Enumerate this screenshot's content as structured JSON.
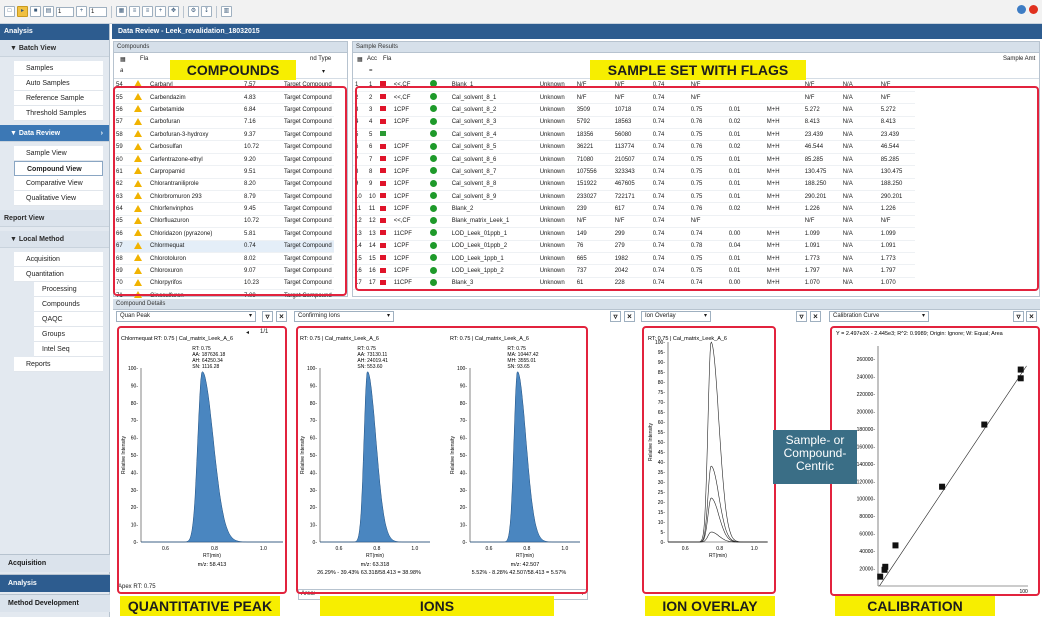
{
  "toolbar": {
    "field1": "1",
    "field2": "1"
  },
  "leftnav": {
    "header": "Analysis",
    "batch_view": {
      "title": "Batch View",
      "items": [
        "Samples",
        "Auto Samples",
        "Reference Sample",
        "Threshold Samples"
      ]
    },
    "data_review": {
      "title": "Data Review",
      "items": [
        "Sample View",
        "Compound View",
        "Comparative View",
        "Qualitative View"
      ]
    },
    "report_view": "Report View",
    "local_method": {
      "title": "Local Method",
      "items": [
        "Acquisition",
        "Quantitation"
      ],
      "sub_items": [
        "Processing",
        "Compounds",
        "QAQC",
        "Groups",
        "Intel Seq"
      ],
      "reports": "Reports"
    },
    "bottom": [
      "Acquisition",
      "Analysis",
      "Method Development"
    ]
  },
  "main": {
    "title": "Data Review - Leek_revalidation_18032015"
  },
  "compounds": {
    "title": "Compounds",
    "col_flag": "Fla",
    "col_type": "nd Type",
    "filter": "a",
    "rows": [
      {
        "n": "54",
        "name": "Carbaryl",
        "rt": "7.57",
        "type": "Target Compound"
      },
      {
        "n": "55",
        "name": "Carbendazim",
        "rt": "4.83",
        "type": "Target Compound"
      },
      {
        "n": "56",
        "name": "Carbetamide",
        "rt": "6.84",
        "type": "Target Compound"
      },
      {
        "n": "57",
        "name": "Carbofuran",
        "rt": "7.16",
        "type": "Target Compound"
      },
      {
        "n": "58",
        "name": "Carbofuran-3-hydroxy",
        "rt": "9.37",
        "type": "Target Compound"
      },
      {
        "n": "59",
        "name": "Carbosulfan",
        "rt": "10.72",
        "type": "Target Compound"
      },
      {
        "n": "60",
        "name": "Carfentrazone-ethyl",
        "rt": "9.20",
        "type": "Target Compound"
      },
      {
        "n": "61",
        "name": "Carpropamid",
        "rt": "9.51",
        "type": "Target Compound"
      },
      {
        "n": "62",
        "name": "Chlorantraniliprole",
        "rt": "8.20",
        "type": "Target Compound"
      },
      {
        "n": "63",
        "name": "Chlorbromuron 293",
        "rt": "8.79",
        "type": "Target Compound"
      },
      {
        "n": "64",
        "name": "Chlorfenvinphos",
        "rt": "9.45",
        "type": "Target Compound"
      },
      {
        "n": "65",
        "name": "Chlorfluazuron",
        "rt": "10.72",
        "type": "Target Compound"
      },
      {
        "n": "66",
        "name": "Chloridazon (pyrazone)",
        "rt": "5.81",
        "type": "Target Compound"
      },
      {
        "n": "67",
        "name": "Chlormequat",
        "rt": "0.74",
        "type": "Target Compound"
      },
      {
        "n": "68",
        "name": "Chlorotoluron",
        "rt": "8.02",
        "type": "Target Compound"
      },
      {
        "n": "69",
        "name": "Chloroxuron",
        "rt": "9.07",
        "type": "Target Compound"
      },
      {
        "n": "70",
        "name": "Chlorpyrifos",
        "rt": "10.23",
        "type": "Target Compound"
      },
      {
        "n": "71",
        "name": "Cinosulfuron",
        "rt": "7.09",
        "type": "Target Compound"
      }
    ]
  },
  "samples": {
    "title": "Sample Results",
    "col_acq": "Acc",
    "col_flag": "Fla",
    "col_amt": "Sample Amt",
    "filter": "=",
    "rows": [
      {
        "idx": "1",
        "flags": "<<,CF",
        "name": "Blank_1",
        "type": "Unknown",
        "a": "N/F",
        "b": "N/F",
        "c": "0.74",
        "d": "N/F",
        "e": "",
        "f": "",
        "g": "N/F",
        "h": "N/A",
        "i": "N/F"
      },
      {
        "idx": "2",
        "flags": "<<,CF",
        "name": "Cal_solvent_8_1",
        "type": "Unknown",
        "a": "N/F",
        "b": "N/F",
        "c": "0.74",
        "d": "N/F",
        "e": "",
        "f": "",
        "g": "N/F",
        "h": "N/A",
        "i": "N/F"
      },
      {
        "idx": "3",
        "flags": "1CPF",
        "name": "Cal_solvent_8_2",
        "type": "Unknown",
        "a": "3509",
        "b": "10718",
        "c": "0.74",
        "d": "0.75",
        "e": "0.01",
        "f": "M+H",
        "g": "5.272",
        "h": "N/A",
        "i": "5.272"
      },
      {
        "idx": "4",
        "flags": "1CPF",
        "name": "Cal_solvent_8_3",
        "type": "Unknown",
        "a": "5792",
        "b": "18563",
        "c": "0.74",
        "d": "0.76",
        "e": "0.02",
        "f": "M+H",
        "g": "8.413",
        "h": "N/A",
        "i": "8.413"
      },
      {
        "idx": "5",
        "flags": "",
        "name": "Cal_solvent_8_4",
        "type": "Unknown",
        "a": "18356",
        "b": "56080",
        "c": "0.74",
        "d": "0.75",
        "e": "0.01",
        "f": "M+H",
        "g": "23.439",
        "h": "N/A",
        "i": "23.439"
      },
      {
        "idx": "6",
        "flags": "1CPF",
        "name": "Cal_solvent_8_5",
        "type": "Unknown",
        "a": "36221",
        "b": "113774",
        "c": "0.74",
        "d": "0.76",
        "e": "0.02",
        "f": "M+H",
        "g": "46.544",
        "h": "N/A",
        "i": "46.544"
      },
      {
        "idx": "7",
        "flags": "1CPF",
        "name": "Cal_solvent_8_6",
        "type": "Unknown",
        "a": "71080",
        "b": "210507",
        "c": "0.74",
        "d": "0.75",
        "e": "0.01",
        "f": "M+H",
        "g": "85.285",
        "h": "N/A",
        "i": "85.285"
      },
      {
        "idx": "8",
        "flags": "1CPF",
        "name": "Cal_solvent_8_7",
        "type": "Unknown",
        "a": "107556",
        "b": "323343",
        "c": "0.74",
        "d": "0.75",
        "e": "0.01",
        "f": "M+H",
        "g": "130.475",
        "h": "N/A",
        "i": "130.475"
      },
      {
        "idx": "9",
        "flags": "1CPF",
        "name": "Cal_solvent_8_8",
        "type": "Unknown",
        "a": "151922",
        "b": "467605",
        "c": "0.74",
        "d": "0.75",
        "e": "0.01",
        "f": "M+H",
        "g": "188.250",
        "h": "N/A",
        "i": "188.250"
      },
      {
        "idx": "10",
        "flags": "1CPF",
        "name": "Cal_solvent_8_9",
        "type": "Unknown",
        "a": "233027",
        "b": "722171",
        "c": "0.74",
        "d": "0.75",
        "e": "0.01",
        "f": "M+H",
        "g": "290.201",
        "h": "N/A",
        "i": "290.201"
      },
      {
        "idx": "11",
        "flags": "1CPF",
        "name": "Blank_2",
        "type": "Unknown",
        "a": "239",
        "b": "617",
        "c": "0.74",
        "d": "0.76",
        "e": "0.02",
        "f": "M+H",
        "g": "1.226",
        "h": "N/A",
        "i": "1.226"
      },
      {
        "idx": "12",
        "flags": "<<,CF",
        "name": "Blank_matrix_Leek_1",
        "type": "Unknown",
        "a": "N/F",
        "b": "N/F",
        "c": "0.74",
        "d": "N/F",
        "e": "",
        "f": "",
        "g": "N/F",
        "h": "N/A",
        "i": "N/F"
      },
      {
        "idx": "13",
        "flags": "11CPF",
        "name": "LOD_Leek_01ppb_1",
        "type": "Unknown",
        "a": "149",
        "b": "299",
        "c": "0.74",
        "d": "0.74",
        "e": "0.00",
        "f": "M+H",
        "g": "1.099",
        "h": "N/A",
        "i": "1.099"
      },
      {
        "idx": "14",
        "flags": "1CPF",
        "name": "LOD_Leek_01ppb_2",
        "type": "Unknown",
        "a": "76",
        "b": "279",
        "c": "0.74",
        "d": "0.78",
        "e": "0.04",
        "f": "M+H",
        "g": "1.091",
        "h": "N/A",
        "i": "1.091"
      },
      {
        "idx": "15",
        "flags": "1CPF",
        "name": "LOD_Leek_1ppb_1",
        "type": "Unknown",
        "a": "665",
        "b": "1982",
        "c": "0.74",
        "d": "0.75",
        "e": "0.01",
        "f": "M+H",
        "g": "1.773",
        "h": "N/A",
        "i": "1.773"
      },
      {
        "idx": "16",
        "flags": "1CPF",
        "name": "LOD_Leek_1ppb_2",
        "type": "Unknown",
        "a": "737",
        "b": "2042",
        "c": "0.74",
        "d": "0.75",
        "e": "0.01",
        "f": "M+H",
        "g": "1.797",
        "h": "N/A",
        "i": "1.797"
      },
      {
        "idx": "17",
        "flags": "11CPF",
        "name": "Blank_3",
        "type": "Unknown",
        "a": "61",
        "b": "228",
        "c": "0.74",
        "d": "0.74",
        "e": "0.00",
        "f": "M+H",
        "g": "1.070",
        "h": "N/A",
        "i": "1.070"
      }
    ]
  },
  "details": {
    "title": "Compound Details",
    "quan_dropdown": "Quan Peak",
    "ions_dropdown": "Confirming Ions",
    "overlay_dropdown": "Ion Overlay",
    "calib_dropdown": "Calibration Curve",
    "quan_footer": "Apex RT: 0.75",
    "ions_footer": "Area: ",
    "pager": "1/1"
  },
  "annotations": {
    "compounds": "COMPOUNDS",
    "samples": "SAMPLE SET WITH FLAGS",
    "quant": "QUANTITATIVE PEAK",
    "ions": "IONS",
    "overlay": "ION OVERLAY",
    "calib": "CALIBRATION",
    "callout": "Sample- or Compound- Centric"
  },
  "colors": {
    "accent": "#2d5c8f",
    "highlight": "#f7ee00",
    "outline": "#e2233d",
    "peak_fill": "#4a86c0",
    "callout": "#3a6e86"
  },
  "chart_data": [
    {
      "type": "area",
      "header": "Chlormequat  RT: 0.75 | Cal_matrix_Leek_A_6",
      "stats": [
        "RT: 0.75",
        "AA: 187636.18",
        "AH: 64250.34",
        "SN: 1116.28"
      ],
      "xlabel": "RT(min)",
      "ylabel": "Relative Intensity",
      "footer": "m/z: 58.413",
      "x_ticks": [
        "0.6",
        "0.8",
        "1.0"
      ],
      "y_ticks": [
        "0",
        "10",
        "20",
        "30",
        "40",
        "50",
        "60",
        "70",
        "80",
        "90",
        "100"
      ],
      "xlim": [
        0.5,
        1.08
      ],
      "ylim": [
        0,
        100
      ],
      "peak": {
        "apex_rt": 0.75,
        "height": 98
      }
    },
    {
      "type": "area",
      "header": "RT: 0.75 | Cal_matrix_Leek_A_6",
      "stats": [
        "RT: 0.75",
        "AA: 73130.11",
        "AH: 24019.41",
        "SN: 553.60"
      ],
      "xlabel": "RT(min)",
      "ylabel": "Relative Intensity",
      "footer": [
        "m/z: 63.318",
        "26.29% - 39.43% 63.318/58.413 = 38.98%"
      ],
      "x_ticks": [
        "0.6",
        "0.8",
        "1.0"
      ],
      "y_ticks": [
        "0",
        "10",
        "20",
        "30",
        "40",
        "50",
        "60",
        "70",
        "80",
        "90",
        "100"
      ],
      "xlim": [
        0.5,
        1.08
      ],
      "ylim": [
        0,
        100
      ],
      "peak": {
        "apex_rt": 0.75,
        "height": 98
      }
    },
    {
      "type": "area",
      "header": "RT: 0.75 | Cal_matrix_Leek_A_6",
      "stats": [
        "RT: 0.75",
        "MA: 10447.42",
        "MH: 3555.01",
        "SN: 93.65"
      ],
      "xlabel": "RT(min)",
      "ylabel": "Relative Intensity",
      "footer": [
        "m/z: 42.507",
        "5.52% - 8.28% 42.507/58.413 = 5.57%"
      ],
      "x_ticks": [
        "0.6",
        "0.8",
        "1.0"
      ],
      "y_ticks": [
        "0",
        "10",
        "20",
        "30",
        "40",
        "50",
        "60",
        "70",
        "80",
        "90",
        "100"
      ],
      "xlim": [
        0.5,
        1.08
      ],
      "ylim": [
        0,
        100
      ],
      "peak": {
        "apex_rt": 0.75,
        "height": 98
      }
    },
    {
      "type": "line",
      "header": "RT: 0.75 | Cal_matrix_Leek_A_6",
      "xlabel": "RT(min)",
      "ylabel": "Relative Intensity",
      "x_ticks": [
        "0.6",
        "0.8",
        "1.0"
      ],
      "y_ticks": [
        "0",
        "5",
        "10",
        "15",
        "20",
        "25",
        "30",
        "35",
        "40",
        "45",
        "50",
        "55",
        "60",
        "65",
        "70",
        "75",
        "80",
        "85",
        "90",
        "95",
        "100"
      ],
      "xlim": [
        0.5,
        1.08
      ],
      "ylim": [
        0,
        100
      ],
      "series": [
        {
          "apex_rt": 0.75,
          "height": 100
        },
        {
          "apex_rt": 0.75,
          "height": 38
        },
        {
          "apex_rt": 0.75,
          "height": 22
        },
        {
          "apex_rt": 0.75,
          "height": 5
        }
      ]
    },
    {
      "type": "scatter",
      "equation": "Y = 2.497e3X - 2.445e3; R^2: 0.9989; Origin: Ignore; W: Equal; Area",
      "y_ticks": [
        "20000",
        "40000",
        "60000",
        "80000",
        "100000",
        "120000",
        "140000",
        "160000",
        "180000",
        "200000",
        "220000",
        "240000",
        "260000"
      ],
      "x_ticks": [
        "100"
      ],
      "ylim": [
        0,
        275000
      ],
      "xlim": [
        0,
        103
      ],
      "fit": {
        "slope": 2497,
        "intercept": -2445
      },
      "points": [
        {
          "x": 1.5,
          "y": 10718
        },
        {
          "x": 4.5,
          "y": 18563
        },
        {
          "x": 5.0,
          "y": 22000
        },
        {
          "x": 12,
          "y": 46544
        },
        {
          "x": 44,
          "y": 113774
        },
        {
          "x": 73,
          "y": 185000
        },
        {
          "x": 98,
          "y": 238000
        },
        {
          "x": 98,
          "y": 248000
        }
      ]
    }
  ]
}
